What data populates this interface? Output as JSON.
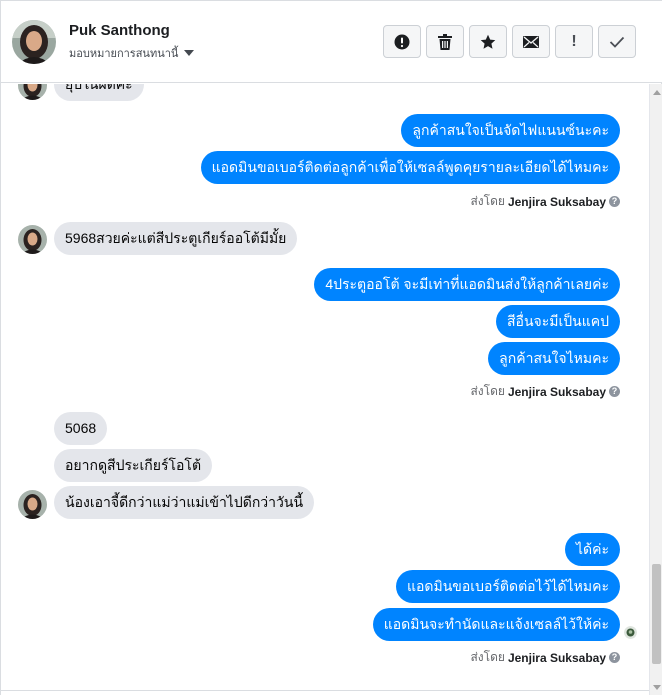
{
  "header": {
    "contact_name": "Puk Santhong",
    "assign_label": "มอบหมายการสนทนานี้",
    "actions": [
      {
        "name": "report",
        "icon": "exclamation-circle-icon"
      },
      {
        "name": "delete",
        "icon": "trash-icon"
      },
      {
        "name": "star",
        "icon": "star-icon"
      },
      {
        "name": "mark-unread",
        "icon": "envelope-icon"
      },
      {
        "name": "follow-up",
        "icon": "exclamation-icon",
        "glyph": "!"
      },
      {
        "name": "mark-done",
        "icon": "check-icon"
      }
    ]
  },
  "messages": {
    "partial_top": "ยุบในผิดคะ",
    "m1": "ลูกค้าสนใจเป็นจัดไฟแนนซ์นะคะ",
    "m2": "แอดมินขอเบอร์ติดต่อลูกค้าเพื่อให้เซลล์พูดคุยรายละเอียดได้ไหมคะ",
    "m3": "5968สวยค่ะแต่สีประตูเกียร์ออโต้มีมั้ย",
    "m4": "4ประตูออโต้ จะมีเท่าที่แอดมินส่งให้ลูกค้าเลยค่ะ",
    "m5": "สีอื่นจะมีเป็นแคป",
    "m6": "ลูกค้าสนใจไหมคะ",
    "m7": "5068",
    "m8": "อยากดูสีประเกียร์โอโต้",
    "m9": "น้องเอาจี้ดีกว่าแม่ว่าแม่เข้าไปดีกว่าวันนี้",
    "m10": "ได้ค่ะ",
    "m11": "แอดมินขอเบอร์ติดต่อไว้ได้ไหมคะ",
    "m12": "แอดมินจะทำนัดและแจ้งเซลล์ไว้ให้ค่ะ"
  },
  "sent_by": {
    "prefix": "ส่งโดย",
    "agent": "Jenjira Suksabay",
    "help_glyph": "?"
  },
  "colors": {
    "outgoing": "#0084ff",
    "incoming": "#e4e6eb"
  }
}
